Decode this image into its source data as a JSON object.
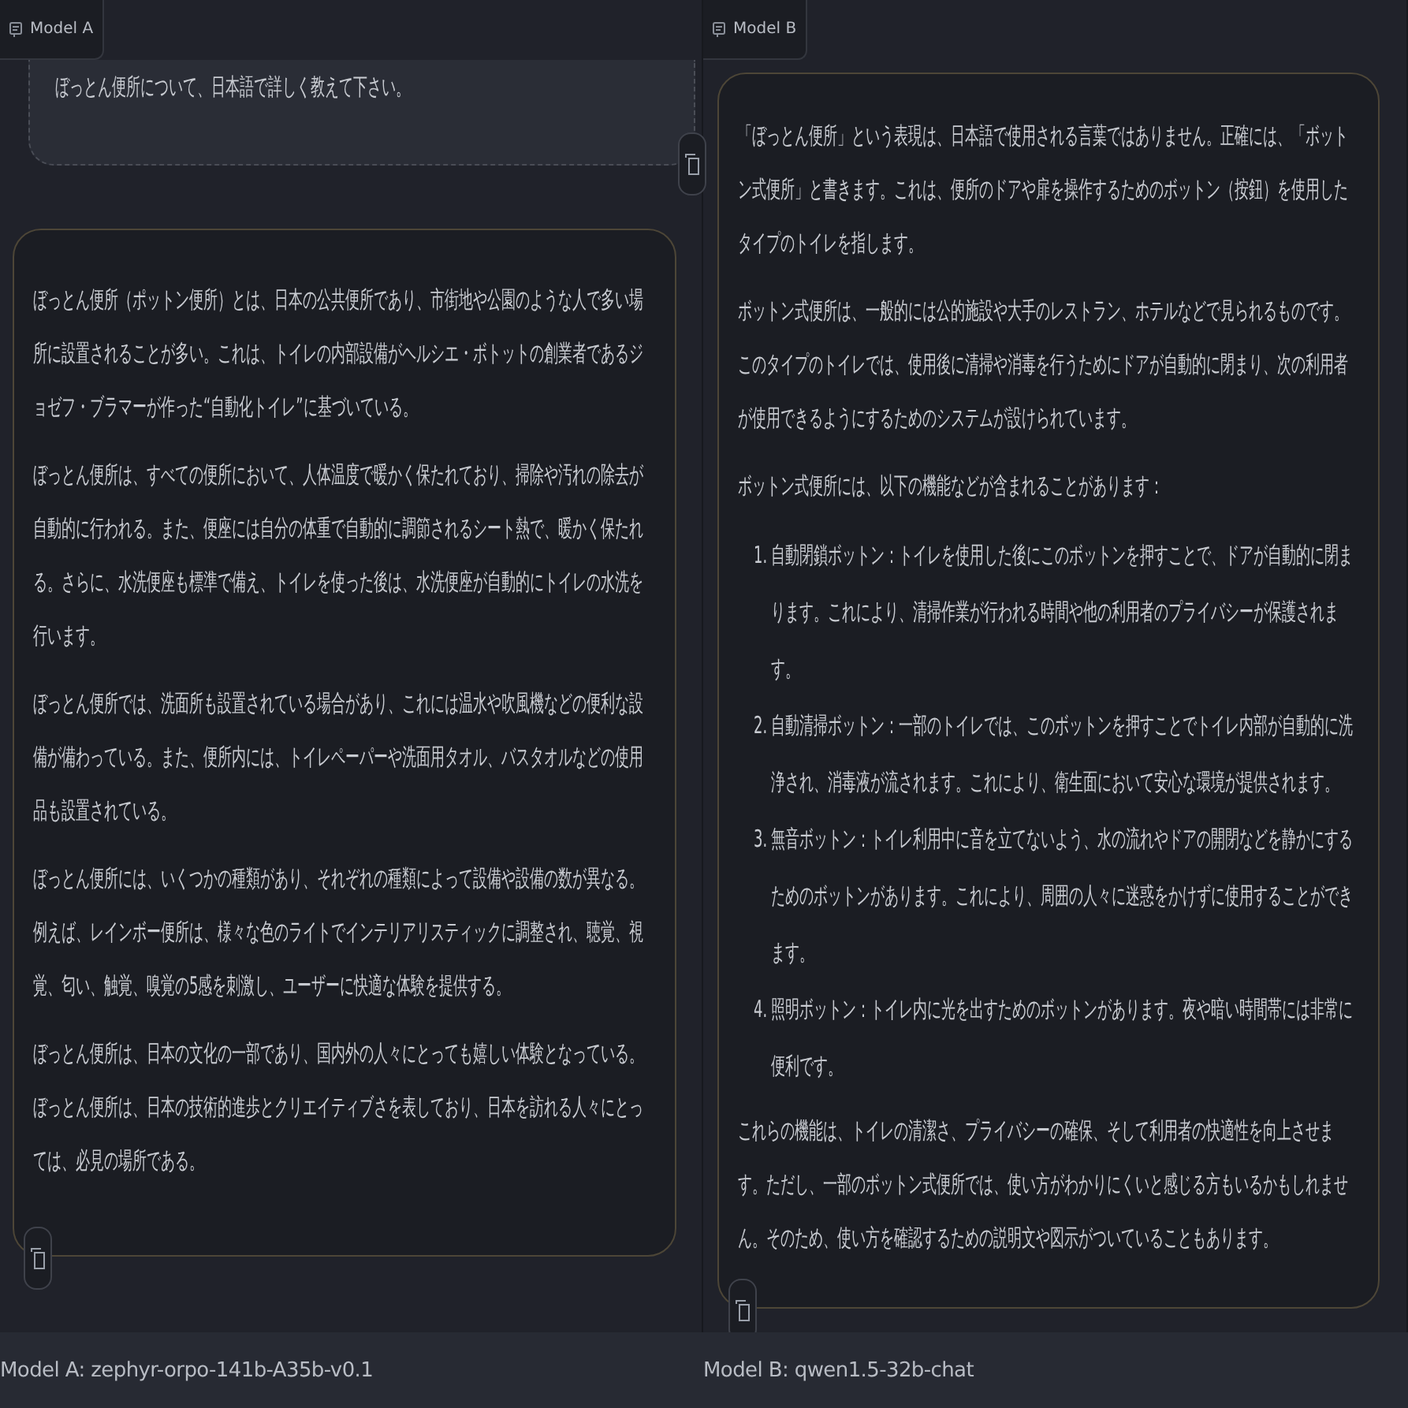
{
  "panels": [
    {
      "tab": "Model A",
      "messages": [
        {
          "kind": "user",
          "blocks": [
            {
              "kind": "paragraph",
              "text": "ぼっとん便所について、日本語で詳しく教えて下さい。"
            }
          ]
        },
        {
          "kind": "assistant",
          "blocks": [
            {
              "kind": "paragraph",
              "text": "ぼっとん便所（ポットン便所）とは、日本の公共便所であり、市街地や公園のような人で多い場所に設置されることが多い。これは、トイレの内部設備がヘルシエ・ボトットの創業者であるジョゼフ・ブラマーが作った“自動化トイレ”に基づいている。"
            },
            {
              "kind": "paragraph",
              "text": "ぼっとん便所は、すべての便所において、人体温度で暖かく保たれており、掃除や汚れの除去が自動的に行われる。また、便座には自分の体重で自動的に調節されるシート熱で、暖かく保たれる。さらに、水洗便座も標準で備え、トイレを使った後は、水洗便座が自動的にトイレの水洗を行います。"
            },
            {
              "kind": "paragraph",
              "text": "ぼっとん便所では、洗面所も設置されている場合があり、これには温水や吹風機などの便利な設備が備わっている。また、便所内には、トイレペーパーや洗面用タオル、バスタオルなどの使用品も設置されている。"
            },
            {
              "kind": "paragraph",
              "text": "ぼっとん便所には、いくつかの種類があり、それぞれの種類によって設備や設備の数が異なる。例えば、レインボー便所は、様々な色のライトでインテリアリスティックに調整され、聴覚、視覚、匂い、触覚、嗅覚の5感を刺激し、ユーザーに快適な体験を提供する。"
            },
            {
              "kind": "paragraph",
              "text": "ぼっとん便所は、日本の文化の一部であり、国内外の人々にとっても嬉しい体験となっている。ぼっとん便所は、日本の技術的進歩とクリエイティブさを表しており、日本を訪れる人々にとっては、必見の場所である。"
            }
          ]
        }
      ],
      "footer": "Model A: zephyr-orpo-141b-A35b-v0.1"
    },
    {
      "tab": "Model B",
      "messages": [
        {
          "kind": "assistant",
          "blocks": [
            {
              "kind": "paragraph",
              "text": "「ぼっとん便所」という表現は、日本語で使用される言葉ではありません。正確には、「ボットン式便所」と書きます。これは、便所のドアや扉を操作するためのボットン（按鈕）を使用したタイプのトイレを指します。"
            },
            {
              "kind": "paragraph",
              "text": "ボットン式便所は、一般的には公的施設や大手のレストラン、ホテルなどで見られるものです。このタイプのトイレでは、使用後に清掃や消毒を行うためにドアが自動的に閉まり、次の利用者が使用できるようにするためのシステムが設けられています。"
            },
            {
              "kind": "paragraph",
              "text": "ボットン式便所には、以下の機能などが含まれることがあります："
            },
            {
              "kind": "list",
              "items": [
                {
                  "number": "1.",
                  "text": "自動閉鎖ボットン：トイレを使用した後にこのボットンを押すことで、ドアが自動的に閉まります。これにより、清掃作業が行われる時間や他の利用者のプライバシーが保護されます。"
                },
                {
                  "number": "2.",
                  "text": "自動清掃ボットン：一部のトイレでは、このボットンを押すことでトイレ内部が自動的に洗浄され、消毒液が流されます。これにより、衛生面において安心な環境が提供されます。"
                },
                {
                  "number": "3.",
                  "text": "無音ボットン：トイレ利用中に音を立てないよう、水の流れやドアの開閉などを静かにするためのボットンがあります。これにより、周囲の人々に迷惑をかけずに使用することができます。"
                },
                {
                  "number": "4.",
                  "text": "照明ボットン：トイレ内に光を出すためのボットンがあります。夜や暗い時間帯には非常に便利です。"
                }
              ]
            },
            {
              "kind": "paragraph",
              "text": "これらの機能は、トイレの清潔さ、プライバシーの確保、そして利用者の快適性を向上させます。ただし、一部のボットン式便所では、使い方がわかりにくいと感じる方もいるかもしれません。そのため、使い方を確認するための説明文や図示がついていることもあります。"
            }
          ]
        }
      ],
      "footer": "Model B: qwen1.5-32b-chat"
    }
  ]
}
